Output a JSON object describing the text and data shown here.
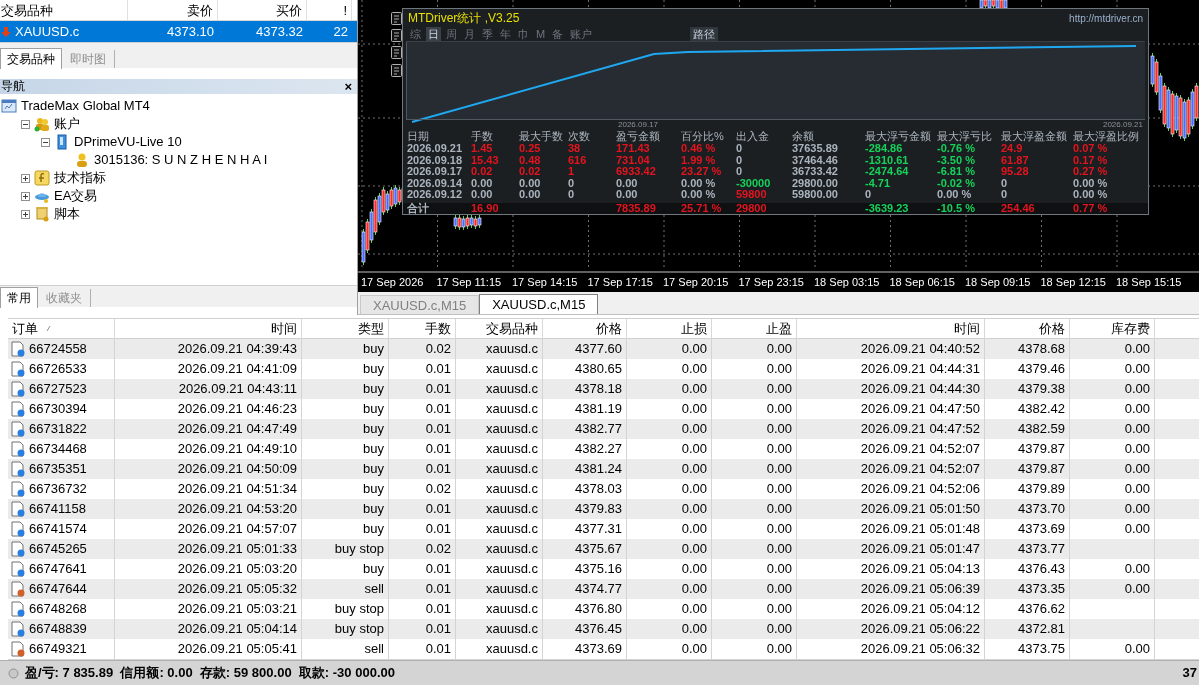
{
  "market_watch": {
    "columns": [
      "交易品种",
      "卖价",
      "买价",
      "!"
    ],
    "rows": [
      {
        "symbol": "XAUUSD.c",
        "bid": "4373.10",
        "ask": "4373.32",
        "spread": "22",
        "selected": true
      }
    ],
    "tabs": [
      {
        "label": "交易品种",
        "selected": true
      },
      {
        "label": "即时图",
        "selected": false
      }
    ]
  },
  "navigator": {
    "title": "导航",
    "close": "×",
    "tree": [
      {
        "label": "TradeMax Global MT4",
        "kind": "server",
        "children": [
          {
            "label": "账户",
            "kind": "accounts",
            "expanded": true,
            "children": [
              {
                "label": "DPrimeVU-Live 10",
                "kind": "broker",
                "expanded": true,
                "children": [
                  {
                    "label": "3015136: S U N Z H E N H A I",
                    "kind": "user"
                  }
                ]
              }
            ]
          },
          {
            "label": "技术指标",
            "kind": "indicator",
            "expanded": false
          },
          {
            "label": "EA交易",
            "kind": "expert",
            "expanded": false
          },
          {
            "label": "脚本",
            "kind": "script",
            "expanded": false
          }
        ]
      }
    ],
    "tabs": [
      {
        "label": "常用",
        "selected": true
      },
      {
        "label": "收藏夹",
        "selected": false
      }
    ]
  },
  "chart": {
    "stats_panel": {
      "title": "MTDriver统计 ,V3.25",
      "url": "http://mtdriver.cn",
      "periods": [
        {
          "label": "综",
          "selected": false
        },
        {
          "label": "日",
          "selected": true
        },
        {
          "label": "周",
          "selected": false
        },
        {
          "label": "月",
          "selected": false
        },
        {
          "label": "季",
          "selected": false
        },
        {
          "label": "年",
          "selected": false
        },
        {
          "label": "巾",
          "selected": false
        },
        {
          "label": "M",
          "selected": false
        },
        {
          "label": "备",
          "selected": false
        },
        {
          "label": "账户",
          "selected": false
        }
      ],
      "path_button": "路径",
      "graph_labels": [
        "2026.09.17",
        "2026.09.21"
      ],
      "columns": [
        {
          "text": "日期"
        },
        {
          "text": "手数"
        },
        {
          "text": "最大手数"
        },
        {
          "text": "次数"
        },
        {
          "text": "盈亏金额"
        },
        {
          "text": "百分比%"
        },
        {
          "text": "出入金"
        },
        {
          "text": "余额"
        },
        {
          "text": "最大浮亏金额"
        },
        {
          "text": "最大浮亏比"
        },
        {
          "text": "最大浮盈金额"
        },
        {
          "text": "最大浮盈比例"
        }
      ],
      "rows": [
        {
          "cells": [
            {
              "text": "2026.09.21",
              "color": "#aab4be"
            },
            {
              "text": "1.45",
              "color": "#e4141e"
            },
            {
              "text": "0.25",
              "color": "#e4141e"
            },
            {
              "text": "38",
              "color": "#e4141e"
            },
            {
              "text": "171.43",
              "color": "#e4141e"
            },
            {
              "text": "0.46 %",
              "color": "#e4141e"
            },
            {
              "text": "0",
              "color": "#aab4be"
            },
            {
              "text": "37635.89",
              "color": "#aab4be"
            },
            {
              "text": "-284.86",
              "color": "#14d25a"
            },
            {
              "text": "-0.76 %",
              "color": "#14d25a"
            },
            {
              "text": "24.9",
              "color": "#e4141e"
            },
            {
              "text": "0.07 %",
              "color": "#e4141e"
            }
          ]
        },
        {
          "cells": [
            {
              "text": "2026.09.18",
              "color": "#aab4be"
            },
            {
              "text": "15.43",
              "color": "#e4141e"
            },
            {
              "text": "0.48",
              "color": "#e4141e"
            },
            {
              "text": "616",
              "color": "#e4141e"
            },
            {
              "text": "731.04",
              "color": "#e4141e"
            },
            {
              "text": "1.99 %",
              "color": "#e4141e"
            },
            {
              "text": "0",
              "color": "#aab4be"
            },
            {
              "text": "37464.46",
              "color": "#aab4be"
            },
            {
              "text": "-1310.61",
              "color": "#14d25a"
            },
            {
              "text": "-3.50 %",
              "color": "#14d25a"
            },
            {
              "text": "61.87",
              "color": "#e4141e"
            },
            {
              "text": "0.17 %",
              "color": "#e4141e"
            }
          ]
        },
        {
          "cells": [
            {
              "text": "2026.09.17",
              "color": "#aab4be"
            },
            {
              "text": "0.02",
              "color": "#e4141e"
            },
            {
              "text": "0.02",
              "color": "#e4141e"
            },
            {
              "text": "1",
              "color": "#e4141e"
            },
            {
              "text": "6933.42",
              "color": "#e4141e"
            },
            {
              "text": "23.27 %",
              "color": "#e4141e"
            },
            {
              "text": "0",
              "color": "#aab4be"
            },
            {
              "text": "36733.42",
              "color": "#aab4be"
            },
            {
              "text": "-2474.64",
              "color": "#14d25a"
            },
            {
              "text": "-6.81 %",
              "color": "#14d25a"
            },
            {
              "text": "95.28",
              "color": "#e4141e"
            },
            {
              "text": "0.27 %",
              "color": "#e4141e"
            }
          ]
        },
        {
          "cells": [
            {
              "text": "2026.09.14",
              "color": "#aab4be"
            },
            {
              "text": "0.00",
              "color": "#aab4be"
            },
            {
              "text": "0.00",
              "color": "#aab4be"
            },
            {
              "text": "0",
              "color": "#aab4be"
            },
            {
              "text": "0.00",
              "color": "#aab4be"
            },
            {
              "text": "0.00 %",
              "color": "#aab4be"
            },
            {
              "text": "-30000",
              "color": "#14d25a"
            },
            {
              "text": "29800.00",
              "color": "#aab4be"
            },
            {
              "text": "-4.71",
              "color": "#14d25a"
            },
            {
              "text": "-0.02 %",
              "color": "#14d25a"
            },
            {
              "text": "0",
              "color": "#aab4be"
            },
            {
              "text": "0.00 %",
              "color": "#aab4be"
            }
          ]
        },
        {
          "cells": [
            {
              "text": "2026.09.12",
              "color": "#aab4be"
            },
            {
              "text": "0.00",
              "color": "#aab4be"
            },
            {
              "text": "0.00",
              "color": "#aab4be"
            },
            {
              "text": "0",
              "color": "#aab4be"
            },
            {
              "text": "0.00",
              "color": "#aab4be"
            },
            {
              "text": "0.00 %",
              "color": "#aab4be"
            },
            {
              "text": "59800",
              "color": "#e4141e"
            },
            {
              "text": "59800.00",
              "color": "#aab4be"
            },
            {
              "text": "0",
              "color": "#aab4be"
            },
            {
              "text": "0.00 %",
              "color": "#aab4be"
            },
            {
              "text": "0",
              "color": "#aab4be"
            },
            {
              "text": "0.00 %",
              "color": "#aab4be"
            }
          ]
        }
      ],
      "total": {
        "cells": [
          {
            "text": "合计",
            "color": "#aab4be"
          },
          {
            "text": "16.90",
            "color": "#e4141e"
          },
          null,
          null,
          {
            "text": "7835.89",
            "color": "#e4141e"
          },
          {
            "text": "25.71 %",
            "color": "#e4141e"
          },
          {
            "text": "29800",
            "color": "#e4141e"
          },
          null,
          {
            "text": "-3639.23",
            "color": "#14d25a"
          },
          {
            "text": "-10.5 %",
            "color": "#14d25a"
          },
          {
            "text": "254.46",
            "color": "#e4141e"
          },
          {
            "text": "0.77 %",
            "color": "#e4141e"
          }
        ]
      }
    },
    "time_labels": [
      "17 Sep 2026",
      "17 Sep 11:15",
      "17 Sep 14:15",
      "17 Sep 17:15",
      "17 Sep 20:15",
      "17 Sep 23:15",
      "18 Sep 03:15",
      "18 Sep 06:15",
      "18 Sep 09:15",
      "18 Sep 12:15",
      "18 Sep 15:15"
    ],
    "tabs": [
      {
        "label": "XAUUSD.c,M15",
        "selected": false
      },
      {
        "label": "XAUUSD.c,M15",
        "selected": true
      }
    ]
  },
  "orders": {
    "columns": [
      "订单",
      "时间",
      "类型",
      "手数",
      "交易品种",
      "价格",
      "止损",
      "止盈",
      "时间",
      "价格",
      "库存费"
    ],
    "rows": [
      {
        "kind": "buy",
        "cells": [
          "66724558",
          "2026.09.21 04:39:43",
          "buy",
          "0.02",
          "xauusd.c",
          "4377.60",
          "0.00",
          "0.00",
          "2026.09.21 04:40:52",
          "4378.68",
          "0.00"
        ]
      },
      {
        "kind": "buy",
        "cells": [
          "66726533",
          "2026.09.21 04:41:09",
          "buy",
          "0.01",
          "xauusd.c",
          "4380.65",
          "0.00",
          "0.00",
          "2026.09.21 04:44:31",
          "4379.46",
          "0.00"
        ]
      },
      {
        "kind": "buy",
        "cells": [
          "66727523",
          "2026.09.21 04:43:11",
          "buy",
          "0.01",
          "xauusd.c",
          "4378.18",
          "0.00",
          "0.00",
          "2026.09.21 04:44:30",
          "4379.38",
          "0.00"
        ]
      },
      {
        "kind": "buy",
        "cells": [
          "66730394",
          "2026.09.21 04:46:23",
          "buy",
          "0.01",
          "xauusd.c",
          "4381.19",
          "0.00",
          "0.00",
          "2026.09.21 04:47:50",
          "4382.42",
          "0.00"
        ]
      },
      {
        "kind": "buy",
        "cells": [
          "66731822",
          "2026.09.21 04:47:49",
          "buy",
          "0.01",
          "xauusd.c",
          "4382.77",
          "0.00",
          "0.00",
          "2026.09.21 04:47:52",
          "4382.59",
          "0.00"
        ]
      },
      {
        "kind": "buy",
        "cells": [
          "66734468",
          "2026.09.21 04:49:10",
          "buy",
          "0.01",
          "xauusd.c",
          "4382.27",
          "0.00",
          "0.00",
          "2026.09.21 04:52:07",
          "4379.87",
          "0.00"
        ]
      },
      {
        "kind": "buy",
        "cells": [
          "66735351",
          "2026.09.21 04:50:09",
          "buy",
          "0.01",
          "xauusd.c",
          "4381.24",
          "0.00",
          "0.00",
          "2026.09.21 04:52:07",
          "4379.87",
          "0.00"
        ]
      },
      {
        "kind": "buy",
        "cells": [
          "66736732",
          "2026.09.21 04:51:34",
          "buy",
          "0.02",
          "xauusd.c",
          "4378.03",
          "0.00",
          "0.00",
          "2026.09.21 04:52:06",
          "4379.89",
          "0.00"
        ]
      },
      {
        "kind": "buy",
        "cells": [
          "66741158",
          "2026.09.21 04:53:20",
          "buy",
          "0.01",
          "xauusd.c",
          "4379.83",
          "0.00",
          "0.00",
          "2026.09.21 05:01:50",
          "4373.70",
          "0.00"
        ]
      },
      {
        "kind": "buy",
        "cells": [
          "66741574",
          "2026.09.21 04:57:07",
          "buy",
          "0.01",
          "xauusd.c",
          "4377.31",
          "0.00",
          "0.00",
          "2026.09.21 05:01:48",
          "4373.69",
          "0.00"
        ]
      },
      {
        "kind": "buy",
        "cells": [
          "66745265",
          "2026.09.21 05:01:33",
          "buy stop",
          "0.02",
          "xauusd.c",
          "4375.67",
          "0.00",
          "0.00",
          "2026.09.21 05:01:47",
          "4373.77",
          null
        ]
      },
      {
        "kind": "buy",
        "cells": [
          "66747641",
          "2026.09.21 05:03:20",
          "buy",
          "0.01",
          "xauusd.c",
          "4375.16",
          "0.00",
          "0.00",
          "2026.09.21 05:04:13",
          "4376.43",
          "0.00"
        ]
      },
      {
        "kind": "sell",
        "cells": [
          "66747644",
          "2026.09.21 05:05:32",
          "sell",
          "0.01",
          "xauusd.c",
          "4374.77",
          "0.00",
          "0.00",
          "2026.09.21 05:06:39",
          "4373.35",
          "0.00"
        ]
      },
      {
        "kind": "buy",
        "cells": [
          "66748268",
          "2026.09.21 05:03:21",
          "buy stop",
          "0.01",
          "xauusd.c",
          "4376.80",
          "0.00",
          "0.00",
          "2026.09.21 05:04:12",
          "4376.62",
          null
        ]
      },
      {
        "kind": "buy",
        "cells": [
          "66748839",
          "2026.09.21 05:04:14",
          "buy stop",
          "0.01",
          "xauusd.c",
          "4376.45",
          "0.00",
          "0.00",
          "2026.09.21 05:06:22",
          "4372.81",
          null
        ]
      },
      {
        "kind": "sell",
        "cells": [
          "66749321",
          "2026.09.21 05:05:41",
          "sell",
          "0.01",
          "xauusd.c",
          "4373.69",
          "0.00",
          "0.00",
          "2026.09.21 05:06:32",
          "4373.75",
          "0.00"
        ]
      }
    ],
    "summary": "盈/亏: 7 835.89  信用额: 0.00  存款: 59 800.00  取款: -30 000.00",
    "summary_total": "37"
  }
}
